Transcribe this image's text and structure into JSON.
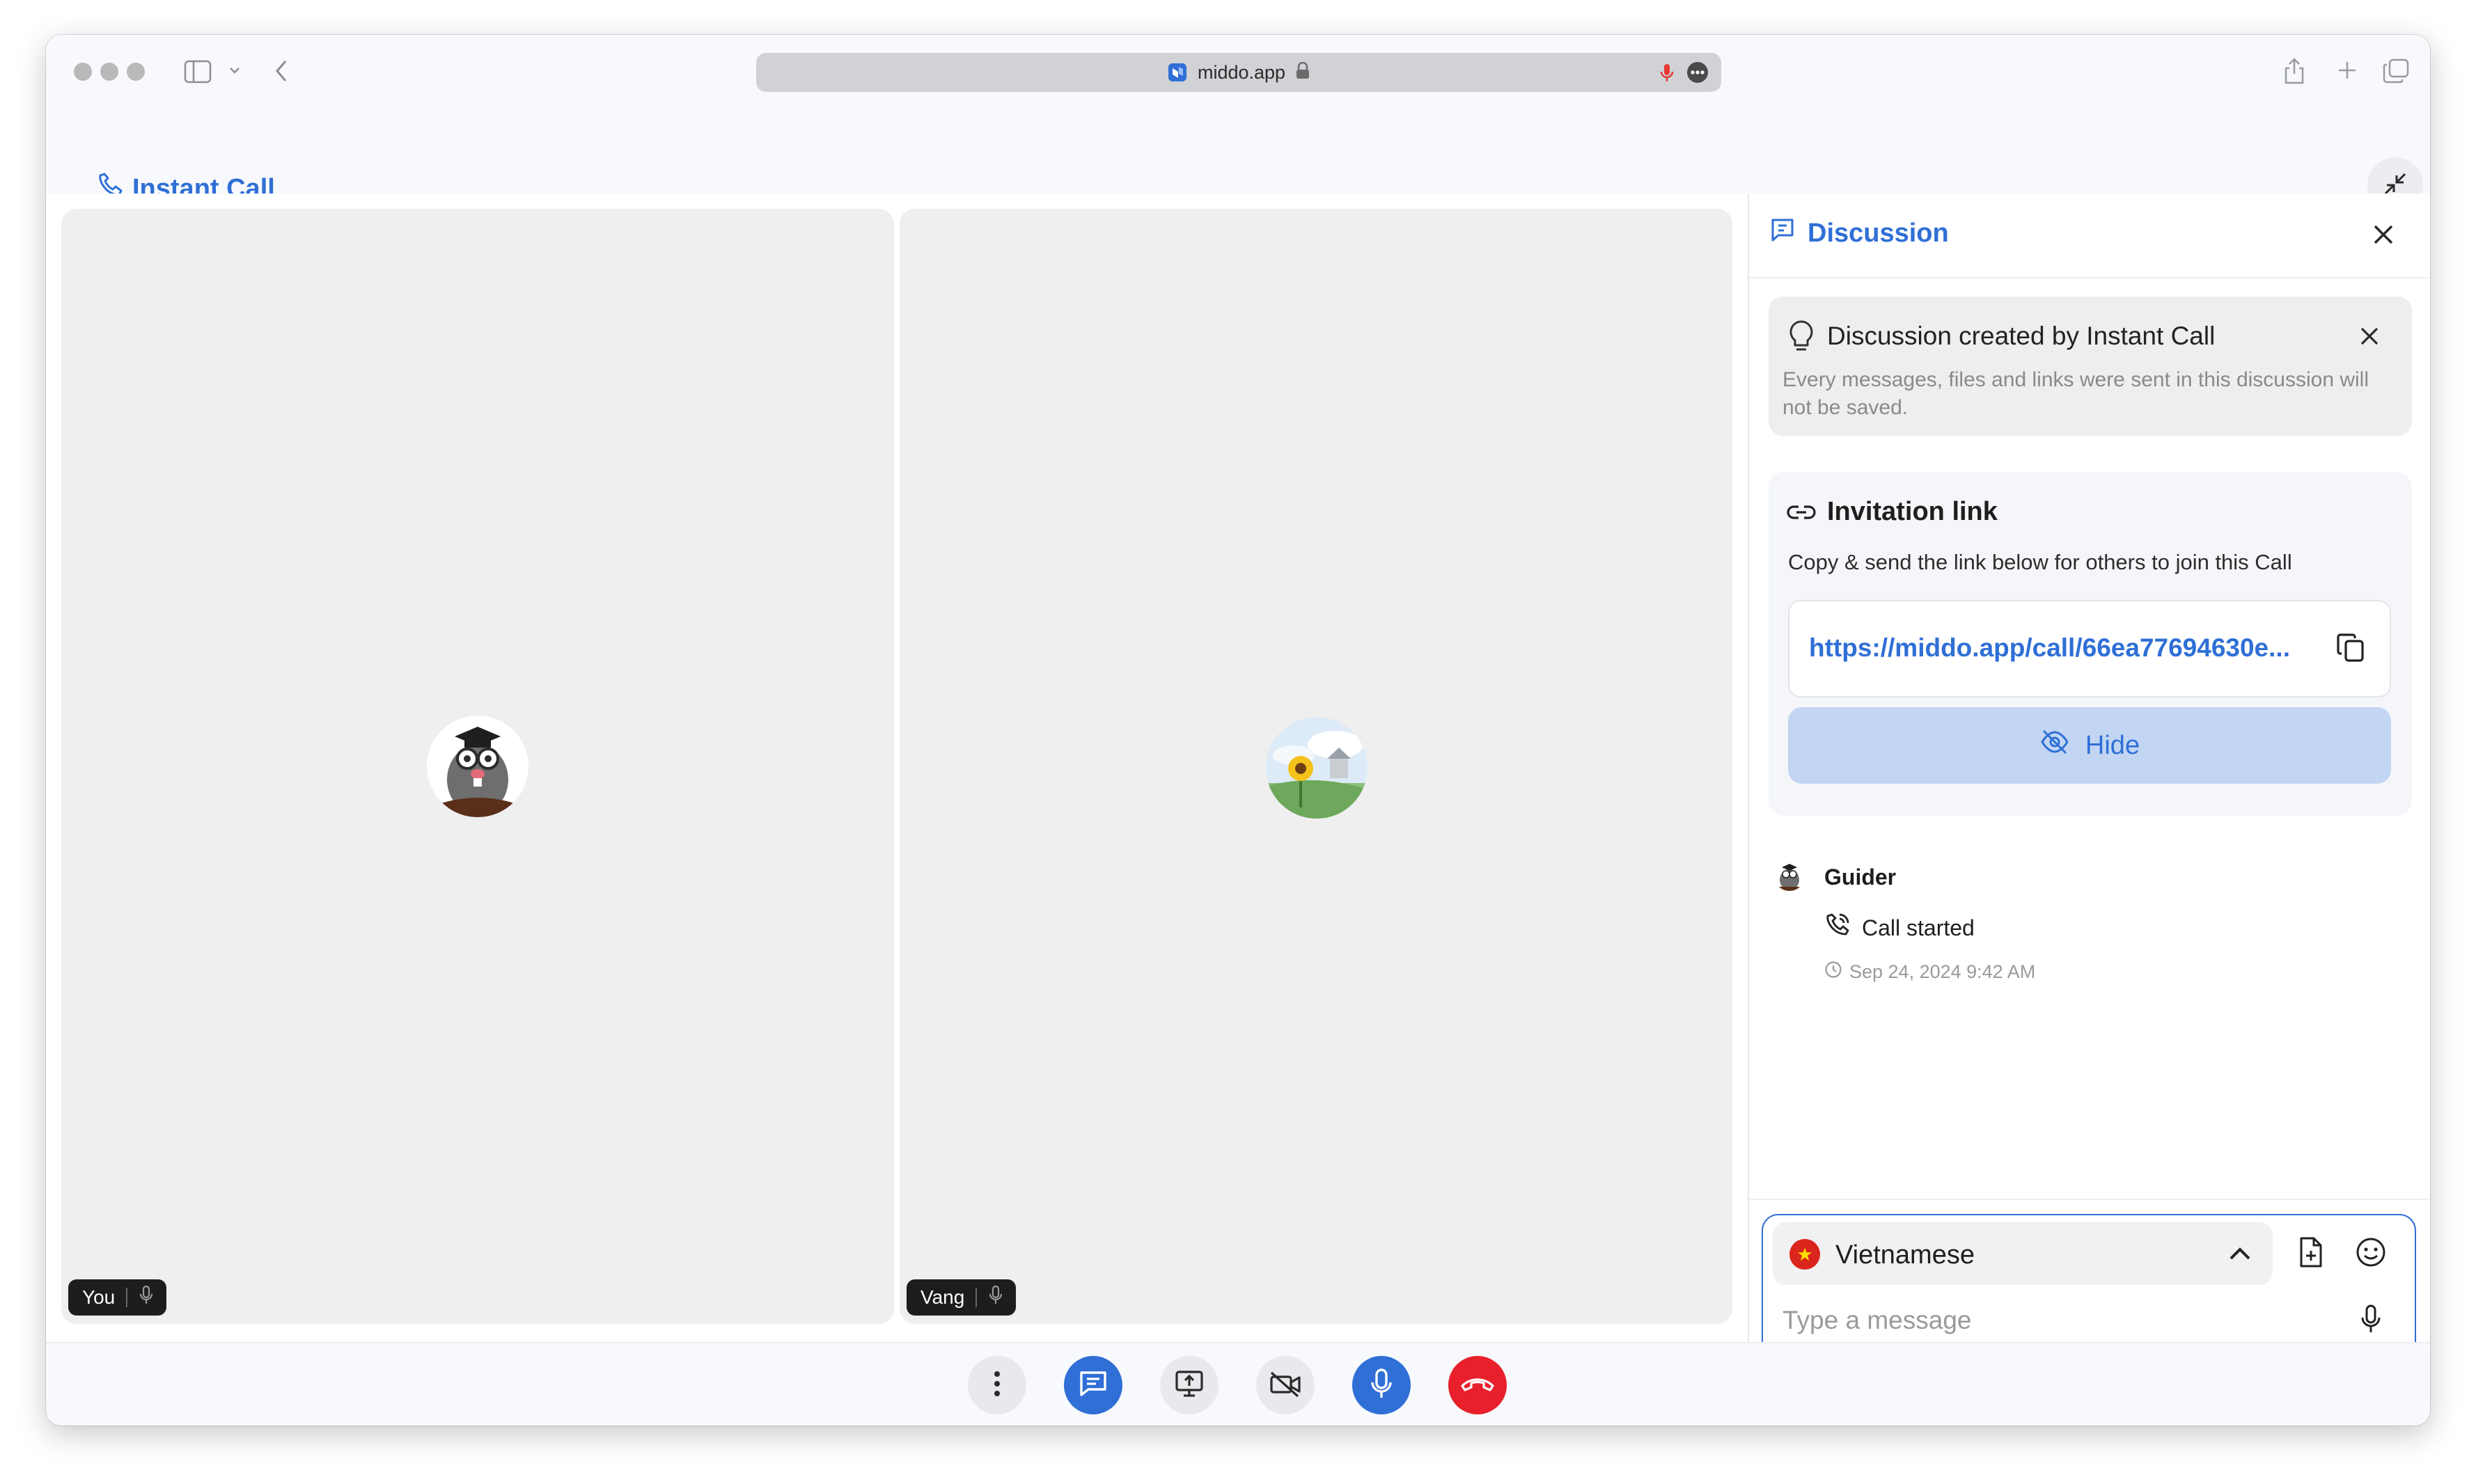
{
  "browser": {
    "url": "middo.app",
    "colors": {
      "mic_indicator": "#e53935"
    }
  },
  "header": {
    "title": "Instant Call",
    "accent": "#2f6fd6"
  },
  "participants": [
    {
      "name": "You",
      "avatar": "mole-graduate-avatar"
    },
    {
      "name": "Vang",
      "avatar": "sunflower-landscape-avatar"
    }
  ],
  "discussion": {
    "title": "Discussion",
    "notice": {
      "title": "Discussion created by Instant Call",
      "text": "Every messages, files and links were sent in this discussion will not be saved."
    },
    "invitation": {
      "title": "Invitation link",
      "description": "Copy & send the link below for others to join this Call",
      "link": "https://middo.app/call/66ea77694630e...",
      "hide_label": "Hide"
    },
    "messages": [
      {
        "sender": "Guider",
        "event": "Call started",
        "time": "Sep 24, 2024 9:42 AM"
      }
    ],
    "composer": {
      "language": "Vietnamese",
      "placeholder": "Type a message"
    }
  },
  "toolbar": {
    "buttons": [
      "more",
      "chat",
      "share-screen",
      "camera-off",
      "microphone",
      "end-call"
    ],
    "colors": {
      "primary": "#2f6fd6",
      "danger": "#e8202b",
      "neutral": "#e7e9ec"
    }
  }
}
